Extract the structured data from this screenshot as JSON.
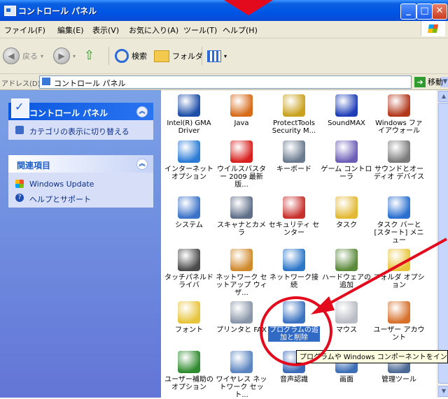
{
  "window": {
    "title": "コントロール パネル"
  },
  "menu": [
    "ファイル(F)",
    "編集(E)",
    "表示(V)",
    "お気に入り(A)",
    "ツール(T)",
    "ヘルプ(H)"
  ],
  "toolbar": {
    "back": "戻る",
    "search": "検索",
    "folders": "フォルダ"
  },
  "address": {
    "label": "アドレス(D)",
    "value": "コントロール パネル",
    "go": "移動"
  },
  "left_panel": {
    "panel_title": "コントロール パネル",
    "switch_view": "カテゴリの表示に切り替える",
    "related_title": "関連項目",
    "related_links": [
      "Windows Update",
      "ヘルプとサポート"
    ]
  },
  "items": [
    {
      "label": "Intel(R) GMA Driver",
      "icon": "intel-gma-icon",
      "color": "#1d4ea8"
    },
    {
      "label": "Java",
      "icon": "java-icon",
      "color": "#d76b1a"
    },
    {
      "label": "ProtectTools Security M...",
      "icon": "protecttools-icon",
      "color": "#c9a21e"
    },
    {
      "label": "SoundMAX",
      "icon": "soundmax-icon",
      "color": "#1f3fb8"
    },
    {
      "label": "Windows ファイアウォール",
      "icon": "firewall-icon",
      "color": "#b3381c"
    },
    {
      "label": "インターネット オプション",
      "icon": "internet-options-icon",
      "color": "#2b7bd6"
    },
    {
      "label": "ウイルスバスター 2009 最新版...",
      "icon": "virusbuster-icon",
      "color": "#d8201e"
    },
    {
      "label": "キーボード",
      "icon": "keyboard-icon",
      "color": "#6a7a8f"
    },
    {
      "label": "ゲーム コントローラ",
      "icon": "game-controller-icon",
      "color": "#6d5fb8"
    },
    {
      "label": "サウンドとオーディオ デバイス",
      "icon": "sound-audio-icon",
      "color": "#7b7b7b"
    },
    {
      "label": "システム",
      "icon": "system-icon",
      "color": "#3c73c9"
    },
    {
      "label": "スキャナとカメラ",
      "icon": "scanner-camera-icon",
      "color": "#5f6f88"
    },
    {
      "label": "セキュリティ センター",
      "icon": "security-center-icon",
      "color": "#c8302c"
    },
    {
      "label": "タスク",
      "icon": "tasks-icon",
      "color": "#e3b934"
    },
    {
      "label": "タスク バーと [スタート] メニュー",
      "icon": "taskbar-icon",
      "color": "#2a6fd0"
    },
    {
      "label": "タッチパネルドライバ",
      "icon": "touch-panel-icon",
      "color": "#4a4a4a"
    },
    {
      "label": "ネットワーク セットアップ ウィザ...",
      "icon": "network-setup-icon",
      "color": "#d08a2c"
    },
    {
      "label": "ネットワーク接続",
      "icon": "network-connections-icon",
      "color": "#2c76c8"
    },
    {
      "label": "ハードウェアの追加",
      "icon": "add-hardware-icon",
      "color": "#5b8a3a"
    },
    {
      "label": "フォルダ オプション",
      "icon": "folder-options-icon",
      "color": "#e8c43a"
    },
    {
      "label": "フォント",
      "icon": "fonts-icon",
      "color": "#e8c43a"
    },
    {
      "label": "プリンタと FAX",
      "icon": "printers-fax-icon",
      "color": "#8895a8"
    },
    {
      "label": "プログラムの追加と削除",
      "icon": "add-remove-programs-icon",
      "color": "#3a72c0",
      "selected": true
    },
    {
      "label": "マウス",
      "icon": "mouse-icon",
      "color": "#b8bcc4"
    },
    {
      "label": "ユーザー アカウント",
      "icon": "user-accounts-icon",
      "color": "#d6702a"
    },
    {
      "label": "ユーザー補助の オプション",
      "icon": "accessibility-icon",
      "color": "#2e8b2e"
    },
    {
      "label": "ワイヤレス ネットワーク セット...",
      "icon": "wireless-network-icon",
      "color": "#5a84c0"
    },
    {
      "label": "音声認識",
      "icon": "speech-icon",
      "color": "#3a6ab8"
    },
    {
      "label": "画面",
      "icon": "display-icon",
      "color": "#3c6fb6"
    },
    {
      "label": "管理ツール",
      "icon": "admin-tools-icon",
      "color": "#4d6a95"
    }
  ],
  "tooltip": "プログラムや Windows コンポーネントをインストール",
  "colors": {
    "annotation_red": "#e40a1e",
    "selection": "#316ac5"
  }
}
